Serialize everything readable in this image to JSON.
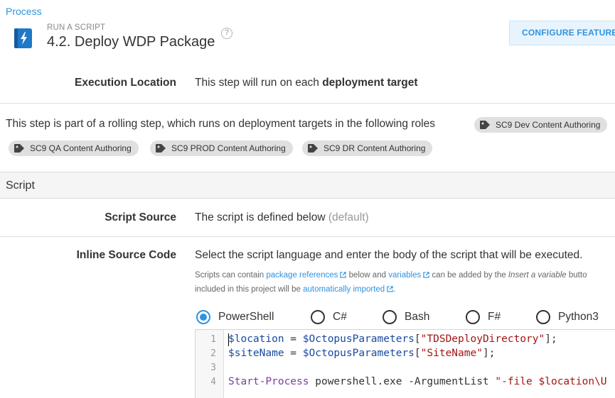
{
  "breadcrumb": "Process",
  "header": {
    "kicker": "RUN A SCRIPT",
    "title": "4.2.  Deploy WDP Package",
    "configure_label": "CONFIGURE FEATURES"
  },
  "execution_location": {
    "label": "Execution Location",
    "value_prefix": "This step will run on each ",
    "value_bold": "deployment target"
  },
  "rolling": {
    "text": "This step is part of a rolling step, which runs on deployment targets in the following roles",
    "roles": [
      "SC9 Dev Content Authoring",
      "SC9 QA Content Authoring",
      "SC9 PROD Content Authoring",
      "SC9 DR Content Authoring"
    ]
  },
  "script_section": {
    "title": "Script"
  },
  "script_source": {
    "label": "Script Source",
    "value": "The script is defined below",
    "default_note": "(default)"
  },
  "inline_source": {
    "label": "Inline Source Code",
    "description": "Select the script language and enter the body of the script that will be executed.",
    "help_1a": "Scripts can contain ",
    "help_link_1": "package references",
    "help_1b": " below and ",
    "help_link_2": "variables",
    "help_1c": " can be added by the ",
    "help_1d": "Insert a variable",
    "help_1e": " butto",
    "help_2a": "included in this project will be ",
    "help_link_3": "automatically imported",
    "help_2b": "."
  },
  "languages": {
    "options": [
      "PowerShell",
      "C#",
      "Bash",
      "F#",
      "Python3"
    ],
    "selected": "PowerShell"
  },
  "code": {
    "line_numbers": [
      "1",
      "2",
      "3",
      "4"
    ],
    "line1": {
      "var1": "$location",
      "op": " = ",
      "var2": "$OctopusParameters",
      "b1": "[",
      "str": "\"TDSDeployDirectory\"",
      "b2": "];"
    },
    "line2": {
      "var1": "$siteName",
      "op": " = ",
      "var2": "$OctopusParameters",
      "b1": "[",
      "str": "\"SiteName\"",
      "b2": "];"
    },
    "line4": {
      "cmd": "Start-Process",
      "rest": " powershell.exe -ArgumentList ",
      "str": "\"-file $location\\U"
    }
  },
  "colors": {
    "accent": "#2f93e0",
    "chip_bg": "#e0e0e0"
  }
}
